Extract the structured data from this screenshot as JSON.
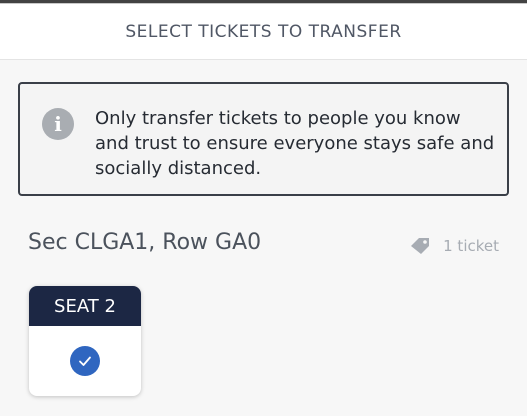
{
  "header": {
    "title": "SELECT TICKETS TO TRANSFER"
  },
  "notice": {
    "icon": "info-icon",
    "line1": "Only transfer tickets to people you know",
    "line2": "and trust to ensure everyone stays safe and",
    "line3": "socially distanced."
  },
  "section": {
    "title": "Sec CLGA1, Row GA0",
    "count_icon": "ticket-tag-icon",
    "count_label": "1 ticket"
  },
  "seats": [
    {
      "label": "SEAT 2",
      "selected": true
    }
  ],
  "colors": {
    "seat_header": "#1c2744",
    "check_accent": "#2f66c0",
    "notice_border": "#3a3f48"
  }
}
